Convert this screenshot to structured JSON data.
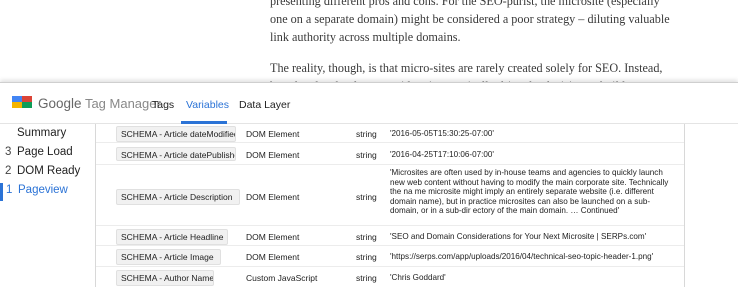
{
  "article": {
    "paragraph1": "presenting different pros and cons. For the SEO-purist, the microsite (especially one on a separate domain) might be considered a poor strategy – diluting valuable link authority across multiple domains.",
    "paragraph2": "The reality, though, is that micro-sites are rarely created solely for SEO. Instead, brand and technology considerations typically drive the decision to build a separate site"
  },
  "header": {
    "brand_google": "Google",
    "brand_product": "Tag Manager",
    "tabs": [
      {
        "label": "Tags",
        "active": false
      },
      {
        "label": "Variables",
        "active": true
      },
      {
        "label": "Data Layer",
        "active": false
      }
    ]
  },
  "sidebar": {
    "items": [
      {
        "num": "",
        "label": "Summary",
        "selected": false
      },
      {
        "num": "3",
        "label": "Page Load",
        "selected": false
      },
      {
        "num": "2",
        "label": "DOM Ready",
        "selected": false
      },
      {
        "num": "1",
        "label": "Pageview",
        "selected": true
      }
    ]
  },
  "variables": {
    "rows": [
      {
        "name": "SCHEMA - Article dateModified",
        "type": "DOM Element",
        "data_type": "string",
        "value": "'2016-05-05T15:30:25-07:00'"
      },
      {
        "name": "SCHEMA - Article datePublished",
        "type": "DOM Element",
        "data_type": "string",
        "value": "'2016-04-25T17:10:06-07:00'"
      },
      {
        "name": "SCHEMA - Article Description",
        "type": "DOM Element",
        "data_type": "string",
        "value": "'Microsites are often used by in-house teams and agencies to quickly launch new web content without having to modify the main corporate site. Technically the na me microsite might imply an entirely separate website (i.e. different domain name), but in practice microsites can also be launched on a sub-domain, or in a sub-dir ectory of the main domain. … Continued'"
      },
      {
        "name": "SCHEMA - Article Headline",
        "type": "DOM Element",
        "data_type": "string",
        "value": "'SEO and Domain Considerations for Your Next Microsite | SERPs.com'"
      },
      {
        "name": "SCHEMA - Article Image",
        "type": "DOM Element",
        "data_type": "string",
        "value": "'https://serps.com/app/uploads/2016/04/technical-seo-topic-header-1.png'"
      },
      {
        "name": "SCHEMA - Author Name",
        "type": "Custom JavaScript",
        "data_type": "string",
        "value": "'Chris Goddard'"
      }
    ]
  },
  "colors": {
    "accent": "#2b73d6",
    "logo_blue": "#4285f4",
    "logo_red": "#db4437",
    "logo_yellow": "#f4b400",
    "logo_green": "#0f9d58"
  }
}
